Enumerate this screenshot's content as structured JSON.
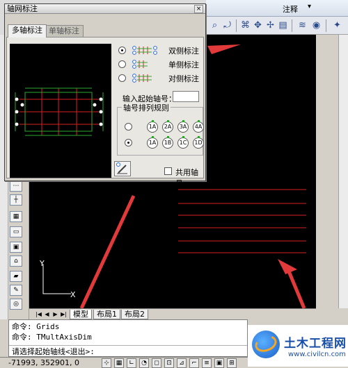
{
  "dialog": {
    "title": "轴网标注",
    "close_label": "×",
    "tabs": [
      {
        "label": "多轴标注",
        "active": true
      },
      {
        "label": "单轴标注",
        "active": false
      }
    ],
    "modes": [
      {
        "label": "双侧标注",
        "selected": true
      },
      {
        "label": "单侧标注",
        "selected": false
      },
      {
        "label": "对侧标注",
        "selected": false
      }
    ],
    "start_axis_label": "输入起始轴号：",
    "start_axis_value": "",
    "rule_group_title": "轴号排列规则",
    "rules": [
      {
        "labels": [
          "1A",
          "2A",
          "3A",
          "4A"
        ],
        "selected": false
      },
      {
        "labels": [
          "1A",
          "1B",
          "1C",
          "1D"
        ],
        "selected": true
      }
    ],
    "share_axis_label": "共用轴号",
    "share_axis_checked": false
  },
  "ribbon": {
    "annotation_label": "注释",
    "annotation_arrow": "▾"
  },
  "layout_tabs": [
    "模型",
    "布局1",
    "布局2"
  ],
  "command": {
    "lines": [
      "命令: Grids",
      "命令: TMultAxisDim"
    ],
    "prompt": "请选择起始轴线<退出>:"
  },
  "status": {
    "coords": "-71993, 352901, 0"
  },
  "ucs": {
    "x": "X",
    "y": "Y"
  },
  "watermark": {
    "title": "土木工程网",
    "url": "www.civilcn.com"
  },
  "colors": {
    "drawing_bg": "#000000",
    "grid_red": "#d82020",
    "grid_green": "#2ea82e",
    "arrow_red": "#e23a3a"
  }
}
